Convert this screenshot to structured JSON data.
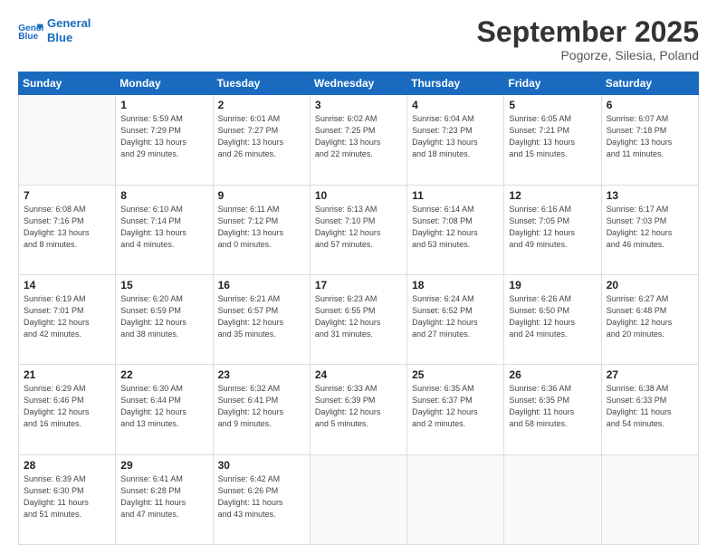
{
  "header": {
    "logo_line1": "General",
    "logo_line2": "Blue",
    "month": "September 2025",
    "location": "Pogorze, Silesia, Poland"
  },
  "weekdays": [
    "Sunday",
    "Monday",
    "Tuesday",
    "Wednesday",
    "Thursday",
    "Friday",
    "Saturday"
  ],
  "weeks": [
    [
      {
        "day": "",
        "info": ""
      },
      {
        "day": "1",
        "info": "Sunrise: 5:59 AM\nSunset: 7:29 PM\nDaylight: 13 hours\nand 29 minutes."
      },
      {
        "day": "2",
        "info": "Sunrise: 6:01 AM\nSunset: 7:27 PM\nDaylight: 13 hours\nand 26 minutes."
      },
      {
        "day": "3",
        "info": "Sunrise: 6:02 AM\nSunset: 7:25 PM\nDaylight: 13 hours\nand 22 minutes."
      },
      {
        "day": "4",
        "info": "Sunrise: 6:04 AM\nSunset: 7:23 PM\nDaylight: 13 hours\nand 18 minutes."
      },
      {
        "day": "5",
        "info": "Sunrise: 6:05 AM\nSunset: 7:21 PM\nDaylight: 13 hours\nand 15 minutes."
      },
      {
        "day": "6",
        "info": "Sunrise: 6:07 AM\nSunset: 7:18 PM\nDaylight: 13 hours\nand 11 minutes."
      }
    ],
    [
      {
        "day": "7",
        "info": "Sunrise: 6:08 AM\nSunset: 7:16 PM\nDaylight: 13 hours\nand 8 minutes."
      },
      {
        "day": "8",
        "info": "Sunrise: 6:10 AM\nSunset: 7:14 PM\nDaylight: 13 hours\nand 4 minutes."
      },
      {
        "day": "9",
        "info": "Sunrise: 6:11 AM\nSunset: 7:12 PM\nDaylight: 13 hours\nand 0 minutes."
      },
      {
        "day": "10",
        "info": "Sunrise: 6:13 AM\nSunset: 7:10 PM\nDaylight: 12 hours\nand 57 minutes."
      },
      {
        "day": "11",
        "info": "Sunrise: 6:14 AM\nSunset: 7:08 PM\nDaylight: 12 hours\nand 53 minutes."
      },
      {
        "day": "12",
        "info": "Sunrise: 6:16 AM\nSunset: 7:05 PM\nDaylight: 12 hours\nand 49 minutes."
      },
      {
        "day": "13",
        "info": "Sunrise: 6:17 AM\nSunset: 7:03 PM\nDaylight: 12 hours\nand 46 minutes."
      }
    ],
    [
      {
        "day": "14",
        "info": "Sunrise: 6:19 AM\nSunset: 7:01 PM\nDaylight: 12 hours\nand 42 minutes."
      },
      {
        "day": "15",
        "info": "Sunrise: 6:20 AM\nSunset: 6:59 PM\nDaylight: 12 hours\nand 38 minutes."
      },
      {
        "day": "16",
        "info": "Sunrise: 6:21 AM\nSunset: 6:57 PM\nDaylight: 12 hours\nand 35 minutes."
      },
      {
        "day": "17",
        "info": "Sunrise: 6:23 AM\nSunset: 6:55 PM\nDaylight: 12 hours\nand 31 minutes."
      },
      {
        "day": "18",
        "info": "Sunrise: 6:24 AM\nSunset: 6:52 PM\nDaylight: 12 hours\nand 27 minutes."
      },
      {
        "day": "19",
        "info": "Sunrise: 6:26 AM\nSunset: 6:50 PM\nDaylight: 12 hours\nand 24 minutes."
      },
      {
        "day": "20",
        "info": "Sunrise: 6:27 AM\nSunset: 6:48 PM\nDaylight: 12 hours\nand 20 minutes."
      }
    ],
    [
      {
        "day": "21",
        "info": "Sunrise: 6:29 AM\nSunset: 6:46 PM\nDaylight: 12 hours\nand 16 minutes."
      },
      {
        "day": "22",
        "info": "Sunrise: 6:30 AM\nSunset: 6:44 PM\nDaylight: 12 hours\nand 13 minutes."
      },
      {
        "day": "23",
        "info": "Sunrise: 6:32 AM\nSunset: 6:41 PM\nDaylight: 12 hours\nand 9 minutes."
      },
      {
        "day": "24",
        "info": "Sunrise: 6:33 AM\nSunset: 6:39 PM\nDaylight: 12 hours\nand 5 minutes."
      },
      {
        "day": "25",
        "info": "Sunrise: 6:35 AM\nSunset: 6:37 PM\nDaylight: 12 hours\nand 2 minutes."
      },
      {
        "day": "26",
        "info": "Sunrise: 6:36 AM\nSunset: 6:35 PM\nDaylight: 11 hours\nand 58 minutes."
      },
      {
        "day": "27",
        "info": "Sunrise: 6:38 AM\nSunset: 6:33 PM\nDaylight: 11 hours\nand 54 minutes."
      }
    ],
    [
      {
        "day": "28",
        "info": "Sunrise: 6:39 AM\nSunset: 6:30 PM\nDaylight: 11 hours\nand 51 minutes."
      },
      {
        "day": "29",
        "info": "Sunrise: 6:41 AM\nSunset: 6:28 PM\nDaylight: 11 hours\nand 47 minutes."
      },
      {
        "day": "30",
        "info": "Sunrise: 6:42 AM\nSunset: 6:26 PM\nDaylight: 11 hours\nand 43 minutes."
      },
      {
        "day": "",
        "info": ""
      },
      {
        "day": "",
        "info": ""
      },
      {
        "day": "",
        "info": ""
      },
      {
        "day": "",
        "info": ""
      }
    ]
  ]
}
